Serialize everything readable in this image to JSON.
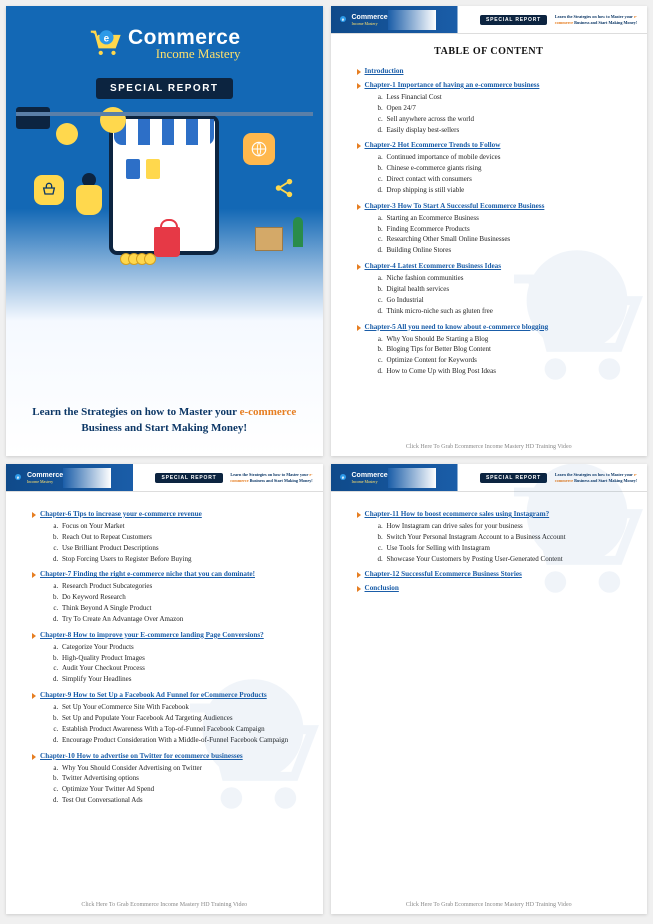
{
  "brand": {
    "title": "Commerce",
    "subtitle": "Income Mastery",
    "badge": "SPECIAL REPORT",
    "tagline_pre": "Learn the Strategies on how to Master your ",
    "tagline_hl": "e-commerce",
    "tagline_post": " Business and Start Making Money!"
  },
  "header": {
    "badge": "SPECIAL REPORT",
    "tag_pre": "Learn the Strategies on how to Master your ",
    "tag_hl": "e-commerce",
    "tag_post": " Business and Start Making Money!"
  },
  "footer": "Click Here To Grab Ecommerce Income Mastery HD Training Video",
  "page2": {
    "title": "TABLE OF CONTENT",
    "items": [
      {
        "label": "Introduction",
        "subs": []
      },
      {
        "label": "Chapter-1   Importance of having an e-commerce business",
        "subs": [
          "Less Financial Cost",
          "Open 24/7",
          "Sell anywhere across the world",
          "Easily display best-sellers"
        ]
      },
      {
        "label": "Chapter-2   Hot Ecommerce Trends to Follow",
        "subs": [
          "Continued importance of mobile devices",
          "Chinese e-commerce giants rising",
          "Direct contact with consumers",
          "Drop shipping is still viable"
        ]
      },
      {
        "label": "Chapter-3   How To Start A Successful Ecommerce Business",
        "subs": [
          "Starting an Ecommerce Business",
          "Finding Ecommerce Products",
          "Researching Other Small Online Businesses",
          "Building Online Stores"
        ]
      },
      {
        "label": "Chapter-4   Latest Ecommerce Business Ideas",
        "subs": [
          "Niche fashion communities",
          "Digital health services",
          "Go Industrial",
          "Think micro-niche such as gluten free"
        ]
      },
      {
        "label": "Chapter-5   All you need to know about e-commerce blogging",
        "subs": [
          "Why You Should Be Starting a Blog",
          "Bloging Tips for Better Blog Content",
          "Optimize Content for Keywords",
          "How to Come Up with Blog Post Ideas"
        ]
      }
    ]
  },
  "page3": {
    "items": [
      {
        "label": "Chapter-6   Tips to increase your e-commerce revenue",
        "subs": [
          "Focus on Your Market",
          "Reach Out to Repeat Customers",
          "Use Brilliant Product Descriptions",
          "Stop Forcing Users to Register Before Buying"
        ]
      },
      {
        "label": "Chapter-7   Finding the right e-commerce niche that you can dominate!",
        "subs": [
          "Research Product Subcategories",
          "Do Keyword Research",
          "Think Beyond A Single Product",
          "Try To Create An Advantage Over Amazon"
        ]
      },
      {
        "label": "Chapter-8   How to improve your E-commerce landing Page Conversions?",
        "subs": [
          "Categorize Your Products",
          "High-Quality Product Images",
          "Audit Your Checkout Process",
          "Simplify Your Headlines"
        ]
      },
      {
        "label": "Chapter-9   How to Set Up a Facebook Ad Funnel for eCommerce Products",
        "subs": [
          "Set Up Your eCommerce Site With Facebook",
          "Set Up and Populate Your Facebook Ad Targeting Audiences",
          "Establish Product Awareness With a Top-of-Funnel Facebook Campaign",
          "Encourage Product Consideration With a Middle-of-Funnel Facebook Campaign"
        ]
      },
      {
        "label": "Chapter-10   How to advertise on Twitter for ecommerce businesses",
        "subs": [
          "Why You Should Consider Advertising on Twitter",
          "Twitter Advertising options",
          "Optimize Your Twitter Ad Spend",
          "Test Out Conversational Ads"
        ]
      }
    ]
  },
  "page4": {
    "items": [
      {
        "label": "Chapter-11   How to boost ecommerce sales using Instagram?",
        "subs": [
          "How Instagram can drive sales for your business",
          "Switch Your Personal Instagram Account to a Business Account",
          "Use Tools for Selling with Instagram",
          "Showcase Your Customers by Posting User-Generated Content"
        ]
      },
      {
        "label": "Chapter-12   Successful Ecommerce Business Stories",
        "subs": []
      },
      {
        "label": "Conclusion",
        "subs": []
      }
    ]
  }
}
